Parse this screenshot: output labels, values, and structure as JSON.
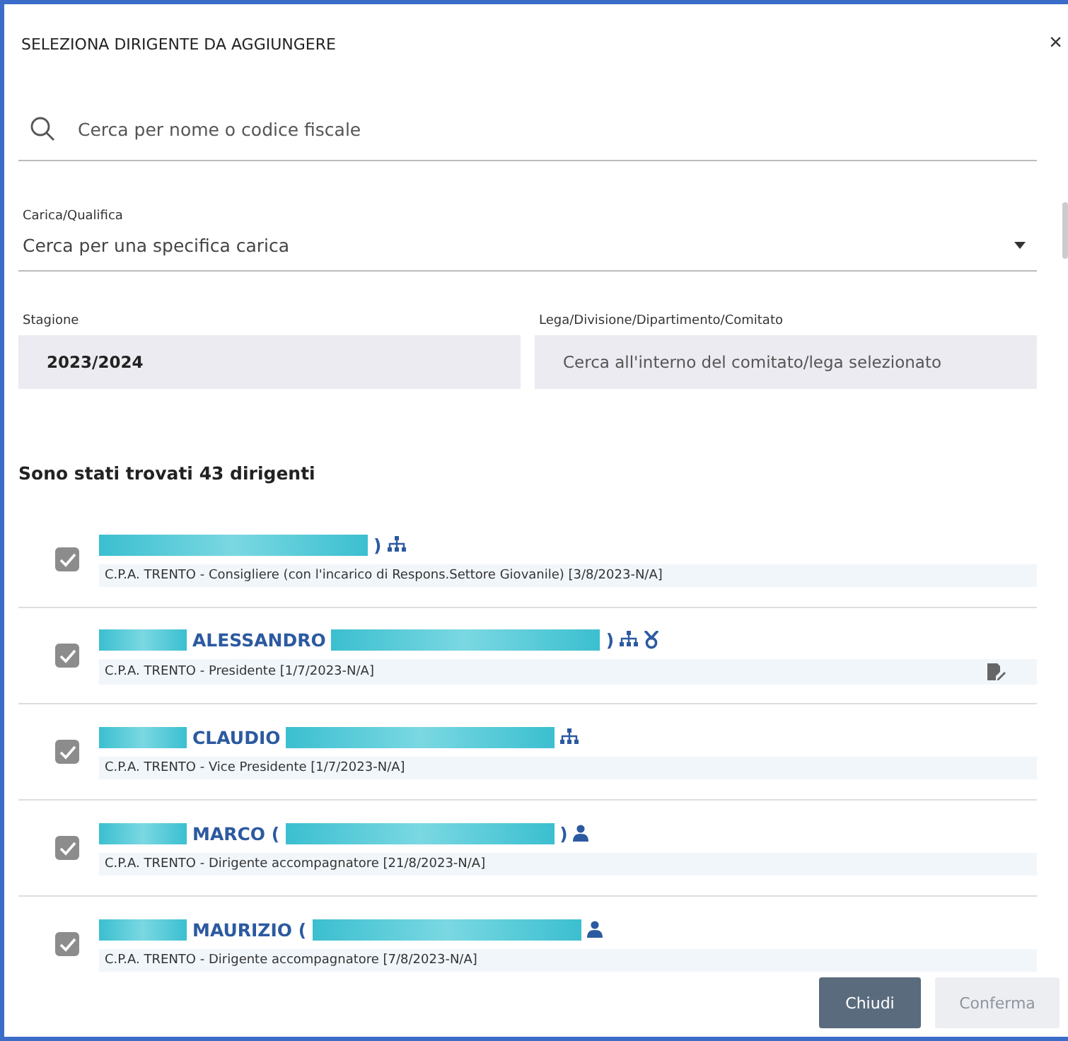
{
  "dialog": {
    "title": "SELEZIONA DIRIGENTE DA AGGIUNGERE",
    "close": "×"
  },
  "search": {
    "placeholder": "Cerca per nome o codice fiscale"
  },
  "role_select": {
    "label": "Carica/Qualifica",
    "placeholder": "Cerca per una specifica carica"
  },
  "season": {
    "label": "Stagione",
    "value": "2023/2024"
  },
  "league": {
    "label": "Lega/Divisione/Dipartimento/Comitato",
    "placeholder": "Cerca all'interno del comitato/lega selezionato"
  },
  "result_count": "Sono stati trovati 43 dirigenti",
  "results": [
    {
      "checked": true,
      "name": [
        {
          "kind": "redacted_long"
        },
        {
          "kind": "text",
          "text": ")"
        }
      ],
      "org_chart": true,
      "medal": false,
      "person": false,
      "detail": "C.P.A. TRENTO - Consigliere (con l'incarico di Respons.Settore Giovanile) [3/8/2023-N/A]",
      "detail_icon": false
    },
    {
      "checked": true,
      "name": [
        {
          "kind": "redacted_short"
        },
        {
          "kind": "text",
          "text": "ALESSANDRO"
        },
        {
          "kind": "redacted_long"
        },
        {
          "kind": "text",
          "text": ")"
        }
      ],
      "org_chart": true,
      "medal": true,
      "person": false,
      "detail": "C.P.A. TRENTO - Presidente [1/7/2023-N/A]",
      "detail_icon": true
    },
    {
      "checked": true,
      "name": [
        {
          "kind": "redacted_short"
        },
        {
          "kind": "text",
          "text": "CLAUDIO"
        },
        {
          "kind": "redacted_long"
        }
      ],
      "org_chart": true,
      "medal": false,
      "person": false,
      "detail": "C.P.A. TRENTO - Vice Presidente [1/7/2023-N/A]",
      "detail_icon": false
    },
    {
      "checked": true,
      "name": [
        {
          "kind": "redacted_short"
        },
        {
          "kind": "text",
          "text": "MARCO ("
        },
        {
          "kind": "redacted_long"
        },
        {
          "kind": "text",
          "text": ")"
        }
      ],
      "org_chart": false,
      "medal": false,
      "person": true,
      "detail": "C.P.A. TRENTO - Dirigente accompagnatore [21/8/2023-N/A]",
      "detail_icon": false
    },
    {
      "checked": true,
      "name": [
        {
          "kind": "redacted_short"
        },
        {
          "kind": "text",
          "text": "MAURIZIO ("
        },
        {
          "kind": "redacted_long"
        }
      ],
      "org_chart": false,
      "medal": false,
      "person": true,
      "detail": "C.P.A. TRENTO - Dirigente accompagnatore [7/8/2023-N/A]",
      "detail_icon": false
    }
  ],
  "buttons": [
    {
      "label": "Chiudi",
      "disabled": false
    },
    {
      "label": "Conferma",
      "disabled": true
    }
  ]
}
